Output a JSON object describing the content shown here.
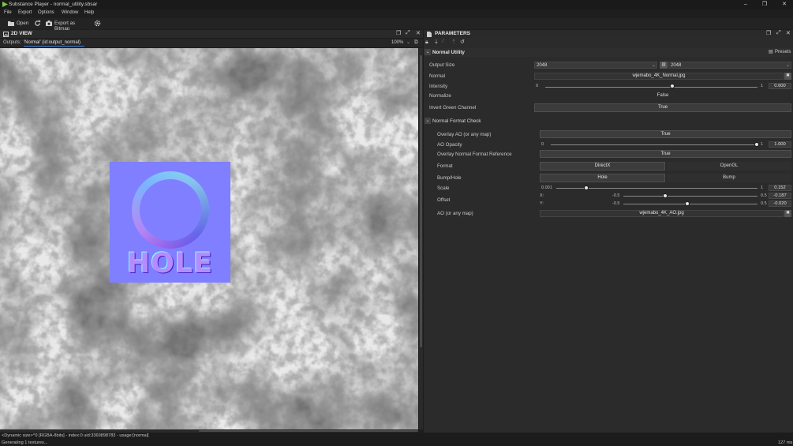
{
  "window": {
    "title": "Substance Player - normal_utility.sbsar",
    "minimize": "–",
    "maximize": "❐",
    "close": "✕"
  },
  "menu": [
    "File",
    "Export",
    "Options",
    "Window",
    "Help"
  ],
  "toolbar": {
    "open_label": "Open",
    "export_label": "Export as Bitmap"
  },
  "view": {
    "title": "2D VIEW",
    "outputs_label": "Outputs:",
    "outputs_value": "'Normal' (id:output_normal)",
    "zoom": "100%",
    "preview_text": "HOLE"
  },
  "params": {
    "title": "PARAMETERS",
    "presets_label": "Presets",
    "group_title": "Normal Utility",
    "output_size_label": "Output Size",
    "output_size_w": "2048",
    "output_size_h": "2048",
    "normal_label": "Normal",
    "normal_file": "wjemabo_4K_Normal.jpg",
    "intensity_label": "Intensity",
    "intensity_min": "0",
    "intensity_max": "1",
    "intensity_value": "0.600",
    "intensity_fraction": 0.6,
    "normalize_label": "Normalize",
    "normalize_value": "False",
    "invert_green_label": "Invert Green Channel",
    "invert_green_value": "True",
    "subgroup_title": "Normal Format Check",
    "overlay_ao_label": "Overlay AO (or any map)",
    "overlay_ao_value": "True",
    "ao_opacity_label": "AO Opacity",
    "ao_opacity_min": "0",
    "ao_opacity_max": "1",
    "ao_opacity_value": "1.000",
    "overlay_ref_label": "Overlay Normal Format Reference",
    "overlay_ref_value": "True",
    "format_label": "Format",
    "format_opt_directx": "DirectX",
    "format_opt_opengl": "OpenGL",
    "bump_hole_label": "Bump/Hole",
    "bump_opt_hole": "Hole",
    "bump_opt_bump": "Bump",
    "scale_label": "Scale",
    "scale_min": "0.001",
    "scale_max": "1",
    "scale_value": "0.152",
    "offset_label": "Offset",
    "offset_x_label": "X:",
    "offset_y_label": "Y:",
    "offset_min": "-0.5",
    "offset_max": "0.5",
    "offset_x_value": "-0.187",
    "offset_y_value": "-0.020",
    "ao_map_label": "AO (or any map)",
    "ao_map_file": "wjemabo_4K_AO.jpg"
  },
  "status": {
    "line1": "<Dynamic size>^0 [RGBA-8bits] - index:0 uid:3369898783 - usage:[normal]",
    "line2": "Generating 1 textures...",
    "memory": "127 ms"
  },
  "colors": {
    "accent_blue": "#3a7bd5",
    "normal_map_bg": "#7f7fff"
  }
}
